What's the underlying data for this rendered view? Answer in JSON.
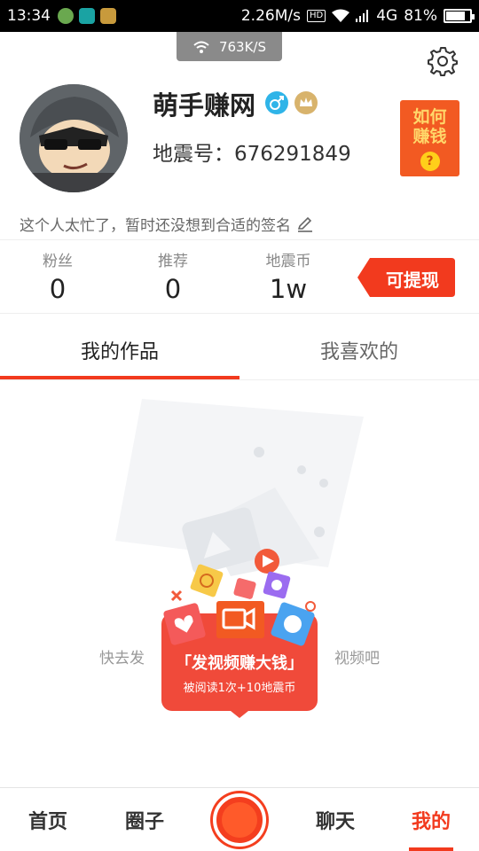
{
  "status_bar": {
    "time": "13:34",
    "speed": "2.26M/s",
    "hd": "HD",
    "network": "4G",
    "battery_pct": 81,
    "battery": "81%"
  },
  "toast": {
    "speed": "763K/S"
  },
  "profile": {
    "name": "萌手赚网",
    "id_label": "地震号：676291849",
    "signature": "这个人太忙了，暂时还没想到合适的签名",
    "earn_badge_line1": "如何",
    "earn_badge_line2": "赚钱",
    "earn_badge_icon": "?"
  },
  "stats": [
    {
      "label": "粉丝",
      "value": "0"
    },
    {
      "label": "推荐",
      "value": "0"
    },
    {
      "label": "地震币",
      "value": "1w"
    }
  ],
  "withdraw": {
    "label": "可提现"
  },
  "tabs": [
    {
      "label": "我的作品"
    },
    {
      "label": "我喜欢的"
    }
  ],
  "empty": {
    "text_left": "快去发",
    "text_right": "视频吧"
  },
  "popup": {
    "title": "「发视频赚大钱」",
    "subtitle": "被阅读1次+10地震币"
  },
  "nav": {
    "home": "首页",
    "circle": "圈子",
    "chat": "聊天",
    "me": "我的"
  },
  "colors": {
    "accent": "#f23a1e",
    "toast": "#8a8a8a"
  }
}
